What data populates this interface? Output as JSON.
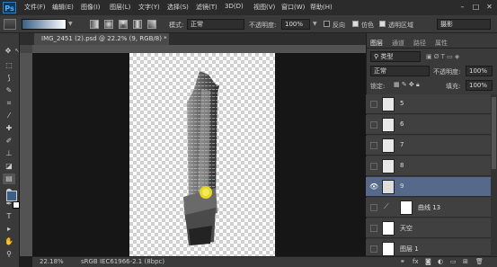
{
  "app": {
    "logo": "Ps"
  },
  "menu": [
    "文件(F)",
    "编辑(E)",
    "图像(I)",
    "图层(L)",
    "文字(Y)",
    "选择(S)",
    "滤镜(T)",
    "3D(D)",
    "视图(V)",
    "窗口(W)",
    "帮助(H)"
  ],
  "window_controls": [
    "–",
    "□",
    "✕"
  ],
  "options": {
    "mode_label": "模式:",
    "mode_value": "正常",
    "opacity_label": "不透明度:",
    "opacity_value": "100%",
    "reverse_label": "反向",
    "dither_label": "仿色",
    "transparency_label": "透明区域",
    "workspace": "摄影"
  },
  "document": {
    "tab_title": "IMG_2451 (2).psd @ 22.2% (9, RGB/8) *",
    "close": "×"
  },
  "status": {
    "zoom": "22.18%",
    "profile": "sRGB IEC61966-2.1 (8bpc)"
  },
  "panel": {
    "tabs": [
      "图层",
      "通道",
      "路径",
      "属性"
    ],
    "filter_label": "类型",
    "blend_mode": "正常",
    "opacity_label": "不透明度:",
    "opacity_value": "100%",
    "lock_label": "锁定:",
    "fill_label": "填充:",
    "fill_value": "100%",
    "layers": [
      {
        "name": "5"
      },
      {
        "name": "6"
      },
      {
        "name": "7"
      },
      {
        "name": "8"
      },
      {
        "name": "9",
        "selected": true
      },
      {
        "name": "曲线 13"
      },
      {
        "name": "天空"
      },
      {
        "name": "图层 1"
      }
    ],
    "footer_icons": [
      "link-icon",
      "fx-icon",
      "mask-icon",
      "adjustment-icon",
      "folder-icon",
      "new-layer-icon",
      "trash-icon"
    ]
  },
  "colors": {
    "foreground": "#3d5f86",
    "background": "#ffffff",
    "accent": "#56698a"
  }
}
